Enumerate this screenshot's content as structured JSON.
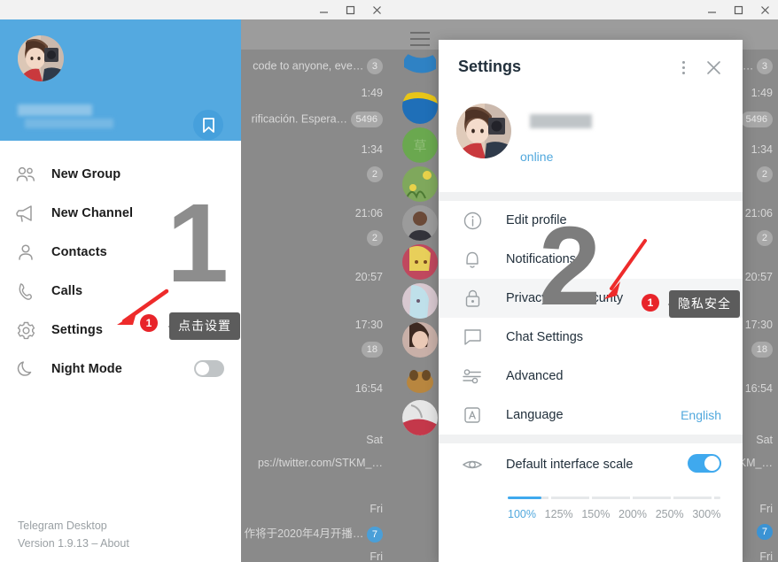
{
  "app": {
    "name": "Telegram Desktop",
    "version": "Version 1.9.13 – About"
  },
  "window_controls": {
    "minimize": "minimize-icon",
    "maximize": "maximize-icon",
    "close": "close-icon"
  },
  "left_window": {
    "profile": {
      "bookmark_icon": "bookmark-icon"
    },
    "menu": [
      {
        "label": "New Group",
        "icon": "group-icon"
      },
      {
        "label": "New Channel",
        "icon": "megaphone-icon"
      },
      {
        "label": "Contacts",
        "icon": "person-icon"
      },
      {
        "label": "Calls",
        "icon": "phone-icon"
      },
      {
        "label": "Settings",
        "icon": "gear-icon"
      },
      {
        "label": "Night Mode",
        "icon": "moon-icon",
        "toggle": "off"
      }
    ],
    "annotation": {
      "step": "1",
      "badge": "1",
      "tooltip": "点击设置"
    },
    "chat_list": [
      {
        "preview": "code to anyone, eve…",
        "badge": "3"
      },
      {
        "time": "1:49"
      },
      {
        "preview": "rificación. Espera…",
        "badge": "5496"
      },
      {
        "time": "1:34",
        "badge": "2"
      },
      {
        "time": "21:06",
        "badge": "2"
      },
      {
        "time": "20:57"
      },
      {
        "time": "17:30",
        "badge": "18"
      },
      {
        "time": "16:54"
      },
      {
        "time": "Sat"
      },
      {
        "preview": "ps://twitter.com/STKM_…"
      },
      {
        "time": "Fri"
      },
      {
        "preview": "作将于2020年4月开播…",
        "badge": "7"
      },
      {
        "time": "Fri"
      }
    ]
  },
  "right_window": {
    "menu_icon": "hamburger-icon",
    "dialog": {
      "title": "Settings",
      "more_icon": "more-vertical-icon",
      "close_icon": "close-icon",
      "profile": {
        "status": "online"
      },
      "rows": [
        {
          "label": "Edit profile",
          "icon": "info-icon"
        },
        {
          "label": "Notifications",
          "icon": "bell-icon"
        },
        {
          "label": "Privacy and Security",
          "icon": "lock-icon",
          "highlighted": true,
          "badge": "1",
          "tooltip": "隐私安全"
        },
        {
          "label": "Chat Settings",
          "icon": "chat-bubble-icon"
        },
        {
          "label": "Advanced",
          "icon": "sliders-icon"
        },
        {
          "label": "Language",
          "icon": "language-icon",
          "value": "English"
        }
      ],
      "scale": {
        "label": "Default interface scale",
        "icon": "eye-icon",
        "toggle": "on",
        "selected": "100%",
        "options": [
          "100%",
          "125%",
          "150%",
          "200%",
          "250%",
          "300%"
        ]
      }
    },
    "annotation": {
      "step": "2"
    },
    "chat_list": [
      {
        "preview": "a…",
        "badge": "3"
      },
      {
        "time": "1:49"
      },
      {
        "badge": "5496"
      },
      {
        "time": "1:34"
      },
      {
        "badge": "2"
      },
      {
        "time": "21:06"
      },
      {
        "badge": "2"
      },
      {
        "time": "20:57"
      },
      {
        "time": "17:30"
      },
      {
        "badge": "18"
      },
      {
        "time": "16:54"
      },
      {
        "time": "Sat"
      },
      {
        "preview": "KM_…"
      },
      {
        "time": "Fri"
      },
      {
        "badge": "7"
      },
      {
        "time": "Fri"
      }
    ]
  },
  "colors": {
    "telegram_blue": "#54a9e0",
    "accent_link": "#51a8dd",
    "badge_red": "#e8242a",
    "tooltip_bg": "#5c5c5c",
    "arrow_red": "#ee2b2b"
  }
}
